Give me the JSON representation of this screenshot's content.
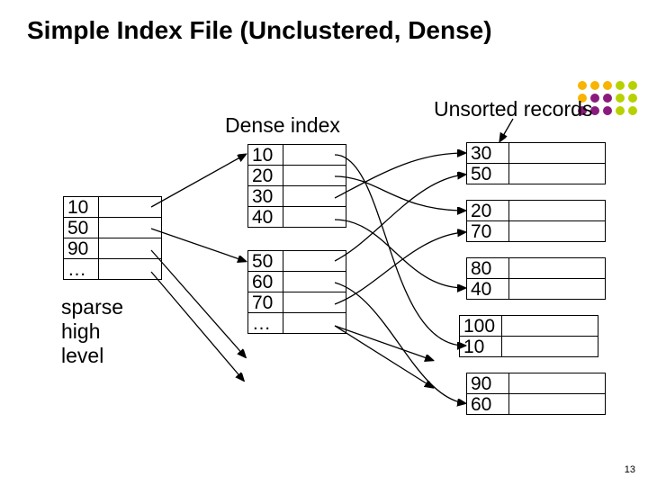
{
  "title": "Simple Index File (Unclustered, Dense)",
  "dense_label": "Dense index",
  "unsorted_label": "Unsorted records",
  "page_number": "13",
  "sparse": {
    "rows": [
      "10",
      "50",
      "90",
      "…"
    ],
    "caption_l1": "sparse",
    "caption_l2": "high",
    "caption_l3": "level"
  },
  "dense": {
    "block1": [
      "10",
      "20",
      "30",
      "40"
    ],
    "block2": [
      "50",
      "60",
      "70",
      "…"
    ]
  },
  "records": {
    "b0": [
      "30",
      "50"
    ],
    "b1": [
      "20",
      "70"
    ],
    "b2": [
      "80",
      "40"
    ],
    "b3": [
      "100",
      "10"
    ],
    "b4": [
      "90",
      "60"
    ]
  },
  "logo_colors": [
    "#f7b400",
    "#f7b400",
    "#f7b400",
    "#b7d100",
    "#b7d100",
    "#f7b400",
    "#8a1b7c",
    "#8a1b7c",
    "#b7d100",
    "#b7d100",
    "#8a1b7c",
    "#8a1b7c",
    "#8a1b7c",
    "#b7d100",
    "#b7d100"
  ]
}
